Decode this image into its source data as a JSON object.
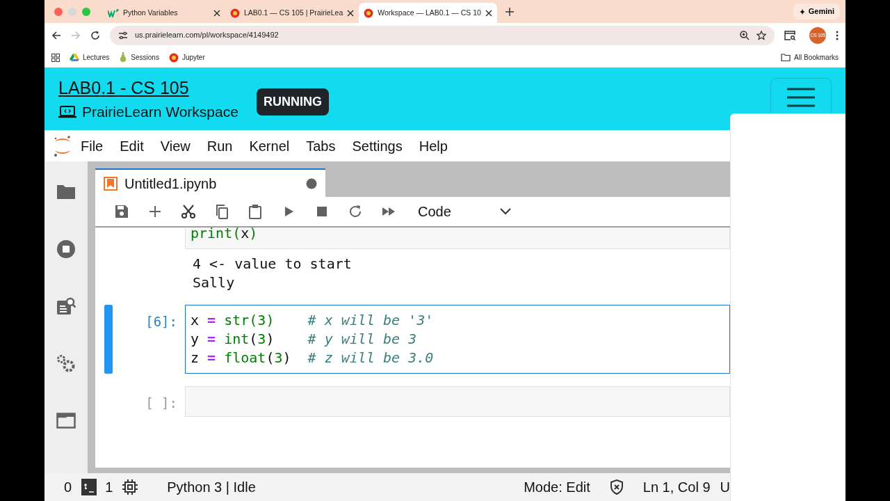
{
  "browser": {
    "tabs": [
      {
        "title": "Python Variables",
        "kind": "w3",
        "selected": false
      },
      {
        "title": "LAB0.1 — CS 105 | PrairieLea",
        "kind": "flower",
        "selected": false
      },
      {
        "title": "Workspace — LAB0.1 — CS 10",
        "kind": "flower",
        "selected": true
      }
    ],
    "gemini": "Gemini",
    "url": "us.prairielearn.com/pl/workspace/4149492",
    "forward_disabled": true,
    "profile": "CS 105",
    "bookmarks": [
      {
        "label": "Lectures",
        "kind": "drive"
      },
      {
        "label": "Sessions",
        "kind": "pear"
      },
      {
        "label": "Jupyter",
        "kind": "flower"
      }
    ],
    "all_bookmarks": "All Bookmarks"
  },
  "header": {
    "title": "LAB0.1 - CS 105",
    "subtitle": "PrairieLearn Workspace",
    "status": "RUNNING"
  },
  "menu": [
    "File",
    "Edit",
    "View",
    "Run",
    "Kernel",
    "Tabs",
    "Settings",
    "Help"
  ],
  "notebook": {
    "tab": {
      "title": "Untitled1.ipynb",
      "dirty": true
    },
    "cell_type": "Code",
    "cells": [
      {
        "active": false,
        "lines": [
          [
            {
              "t": "print",
              "kind": "builtin"
            },
            {
              "t": "(",
              "kind": "match"
            },
            {
              "t": "x",
              "kind": "name"
            },
            {
              "t": ")",
              "kind": "match"
            }
          ]
        ],
        "outputs": [
          "4 <- value to start",
          "Sally"
        ]
      },
      {
        "active": true,
        "prompt": "[6]:",
        "lines": [
          [
            {
              "t": "x ",
              "kind": "name"
            },
            {
              "t": "=",
              "kind": "op"
            },
            {
              "t": " str",
              "kind": "builtin"
            },
            {
              "t": "(",
              "kind": "match"
            },
            {
              "t": "3",
              "kind": "number"
            },
            {
              "t": ")",
              "kind": "match"
            },
            {
              "t": "    # x will be '3'",
              "kind": "comment"
            }
          ],
          [
            {
              "t": "y ",
              "kind": "name"
            },
            {
              "t": "=",
              "kind": "op"
            },
            {
              "t": " int",
              "kind": "builtin"
            },
            {
              "t": "(",
              "kind": "name"
            },
            {
              "t": "3",
              "kind": "number"
            },
            {
              "t": ")",
              "kind": "name"
            },
            {
              "t": "    # y will be 3",
              "kind": "comment"
            }
          ],
          [
            {
              "t": "z ",
              "kind": "name"
            },
            {
              "t": "=",
              "kind": "op"
            },
            {
              "t": " float",
              "kind": "builtin"
            },
            {
              "t": "(",
              "kind": "name"
            },
            {
              "t": "3",
              "kind": "number"
            },
            {
              "t": ")",
              "kind": "name"
            },
            {
              "t": "  # z will be 3.0",
              "kind": "comment"
            }
          ]
        ]
      },
      {
        "active": false,
        "prompt": "[ ]:"
      }
    ]
  },
  "status_bar": {
    "terminals": "0",
    "kernels": "1",
    "kernel": "Python 3 | Idle",
    "mode": "Mode: Edit",
    "position": "Ln 1, Col 9",
    "encoding": "U"
  }
}
